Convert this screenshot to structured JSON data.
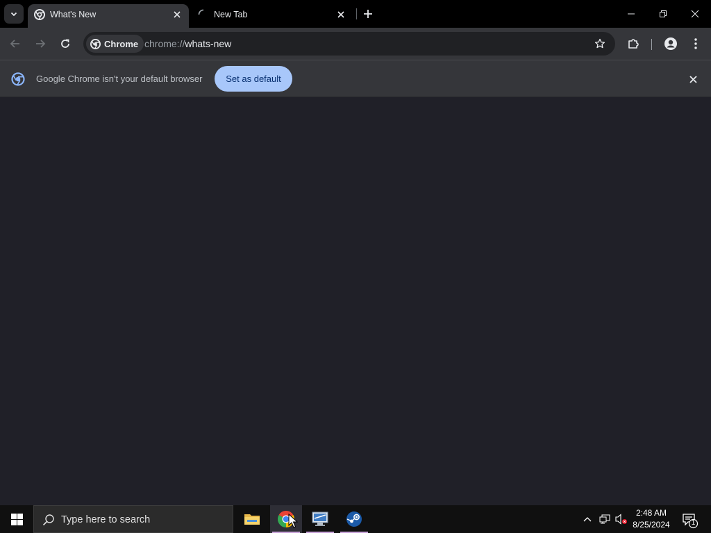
{
  "browser": {
    "tabs": [
      {
        "title": "What's New",
        "active": true
      },
      {
        "title": "New Tab",
        "active": false,
        "loading": true
      }
    ],
    "omnibox": {
      "chip_label": "Chrome",
      "url_scheme": "chrome://",
      "url_host": "whats-new"
    },
    "infobar": {
      "message": "Google Chrome isn't your default browser",
      "button_label": "Set as default"
    },
    "colors": {
      "tabstrip": "#000000",
      "toolbar": "#35363a",
      "omnibox": "#202124",
      "content": "#202028",
      "accent_button": "#a8c7fa"
    }
  },
  "taskbar": {
    "search_placeholder": "Type here to search",
    "apps": [
      "file-explorer",
      "chrome",
      "remote-desktop",
      "steam"
    ],
    "clock_time": "2:48 AM",
    "clock_date": "8/25/2024",
    "notification_count": "1"
  }
}
